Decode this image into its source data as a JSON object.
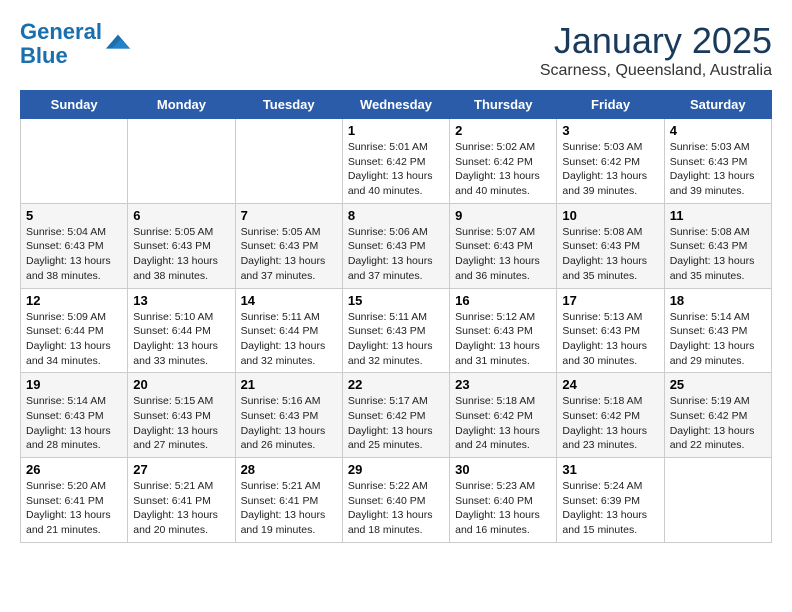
{
  "logo": {
    "line1": "General",
    "line2": "Blue"
  },
  "title": "January 2025",
  "subtitle": "Scarness, Queensland, Australia",
  "days_of_week": [
    "Sunday",
    "Monday",
    "Tuesday",
    "Wednesday",
    "Thursday",
    "Friday",
    "Saturday"
  ],
  "weeks": [
    [
      {
        "day": "",
        "info": ""
      },
      {
        "day": "",
        "info": ""
      },
      {
        "day": "",
        "info": ""
      },
      {
        "day": "1",
        "info": "Sunrise: 5:01 AM\nSunset: 6:42 PM\nDaylight: 13 hours\nand 40 minutes."
      },
      {
        "day": "2",
        "info": "Sunrise: 5:02 AM\nSunset: 6:42 PM\nDaylight: 13 hours\nand 40 minutes."
      },
      {
        "day": "3",
        "info": "Sunrise: 5:03 AM\nSunset: 6:42 PM\nDaylight: 13 hours\nand 39 minutes."
      },
      {
        "day": "4",
        "info": "Sunrise: 5:03 AM\nSunset: 6:43 PM\nDaylight: 13 hours\nand 39 minutes."
      }
    ],
    [
      {
        "day": "5",
        "info": "Sunrise: 5:04 AM\nSunset: 6:43 PM\nDaylight: 13 hours\nand 38 minutes."
      },
      {
        "day": "6",
        "info": "Sunrise: 5:05 AM\nSunset: 6:43 PM\nDaylight: 13 hours\nand 38 minutes."
      },
      {
        "day": "7",
        "info": "Sunrise: 5:05 AM\nSunset: 6:43 PM\nDaylight: 13 hours\nand 37 minutes."
      },
      {
        "day": "8",
        "info": "Sunrise: 5:06 AM\nSunset: 6:43 PM\nDaylight: 13 hours\nand 37 minutes."
      },
      {
        "day": "9",
        "info": "Sunrise: 5:07 AM\nSunset: 6:43 PM\nDaylight: 13 hours\nand 36 minutes."
      },
      {
        "day": "10",
        "info": "Sunrise: 5:08 AM\nSunset: 6:43 PM\nDaylight: 13 hours\nand 35 minutes."
      },
      {
        "day": "11",
        "info": "Sunrise: 5:08 AM\nSunset: 6:43 PM\nDaylight: 13 hours\nand 35 minutes."
      }
    ],
    [
      {
        "day": "12",
        "info": "Sunrise: 5:09 AM\nSunset: 6:44 PM\nDaylight: 13 hours\nand 34 minutes."
      },
      {
        "day": "13",
        "info": "Sunrise: 5:10 AM\nSunset: 6:44 PM\nDaylight: 13 hours\nand 33 minutes."
      },
      {
        "day": "14",
        "info": "Sunrise: 5:11 AM\nSunset: 6:44 PM\nDaylight: 13 hours\nand 32 minutes."
      },
      {
        "day": "15",
        "info": "Sunrise: 5:11 AM\nSunset: 6:43 PM\nDaylight: 13 hours\nand 32 minutes."
      },
      {
        "day": "16",
        "info": "Sunrise: 5:12 AM\nSunset: 6:43 PM\nDaylight: 13 hours\nand 31 minutes."
      },
      {
        "day": "17",
        "info": "Sunrise: 5:13 AM\nSunset: 6:43 PM\nDaylight: 13 hours\nand 30 minutes."
      },
      {
        "day": "18",
        "info": "Sunrise: 5:14 AM\nSunset: 6:43 PM\nDaylight: 13 hours\nand 29 minutes."
      }
    ],
    [
      {
        "day": "19",
        "info": "Sunrise: 5:14 AM\nSunset: 6:43 PM\nDaylight: 13 hours\nand 28 minutes."
      },
      {
        "day": "20",
        "info": "Sunrise: 5:15 AM\nSunset: 6:43 PM\nDaylight: 13 hours\nand 27 minutes."
      },
      {
        "day": "21",
        "info": "Sunrise: 5:16 AM\nSunset: 6:43 PM\nDaylight: 13 hours\nand 26 minutes."
      },
      {
        "day": "22",
        "info": "Sunrise: 5:17 AM\nSunset: 6:42 PM\nDaylight: 13 hours\nand 25 minutes."
      },
      {
        "day": "23",
        "info": "Sunrise: 5:18 AM\nSunset: 6:42 PM\nDaylight: 13 hours\nand 24 minutes."
      },
      {
        "day": "24",
        "info": "Sunrise: 5:18 AM\nSunset: 6:42 PM\nDaylight: 13 hours\nand 23 minutes."
      },
      {
        "day": "25",
        "info": "Sunrise: 5:19 AM\nSunset: 6:42 PM\nDaylight: 13 hours\nand 22 minutes."
      }
    ],
    [
      {
        "day": "26",
        "info": "Sunrise: 5:20 AM\nSunset: 6:41 PM\nDaylight: 13 hours\nand 21 minutes."
      },
      {
        "day": "27",
        "info": "Sunrise: 5:21 AM\nSunset: 6:41 PM\nDaylight: 13 hours\nand 20 minutes."
      },
      {
        "day": "28",
        "info": "Sunrise: 5:21 AM\nSunset: 6:41 PM\nDaylight: 13 hours\nand 19 minutes."
      },
      {
        "day": "29",
        "info": "Sunrise: 5:22 AM\nSunset: 6:40 PM\nDaylight: 13 hours\nand 18 minutes."
      },
      {
        "day": "30",
        "info": "Sunrise: 5:23 AM\nSunset: 6:40 PM\nDaylight: 13 hours\nand 16 minutes."
      },
      {
        "day": "31",
        "info": "Sunrise: 5:24 AM\nSunset: 6:39 PM\nDaylight: 13 hours\nand 15 minutes."
      },
      {
        "day": "",
        "info": ""
      }
    ]
  ]
}
